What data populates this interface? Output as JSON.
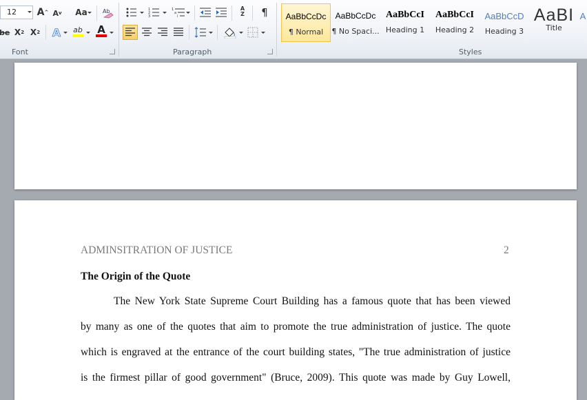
{
  "ribbon": {
    "font": {
      "group_label": "Font",
      "size_value": "12",
      "grow_label": "A",
      "shrink_label": "A",
      "case_label": "Aa",
      "strike_label": "abe",
      "subscript_label": "X",
      "superscript_label": "X",
      "effects_label": "A",
      "highlight_label": "ab",
      "color_label": "A",
      "highlight_color": "#ffff00",
      "font_color": "#e00000"
    },
    "paragraph": {
      "group_label": "Paragraph",
      "pilcrow": "¶",
      "sort_a": "A",
      "sort_z": "Z"
    },
    "styles": {
      "group_label": "Styles",
      "items": [
        {
          "sample": "AaBbCcDc",
          "name": "¶ Normal"
        },
        {
          "sample": "AaBbCcDc",
          "name": "¶ No Spaci..."
        },
        {
          "sample": "AaBbCcI",
          "name": "Heading 1"
        },
        {
          "sample": "AaBbCcI",
          "name": "Heading 2"
        },
        {
          "sample": "AaBbCcD",
          "name": "Heading 3"
        },
        {
          "sample": "AaBI",
          "name": "Title"
        },
        {
          "sample": "A",
          "name": ""
        }
      ],
      "heading3_color": "#4f81bd"
    }
  },
  "document": {
    "header_left": "ADMINSITRATION OF JUSTICE",
    "page_number": "2",
    "heading": "The Origin of the Quote",
    "lines": [
      "The New York State Supreme Court Building has a famous quote that has been viewed",
      "by many as one of the quotes that aim to promote the true administration of justice. The quote",
      "which is engraved at the entrance of the court building states, \"The true administration of justice",
      "is the firmest pillar of good government\" (Bruce, 2009). This quote was made by Guy Lowell,"
    ]
  }
}
